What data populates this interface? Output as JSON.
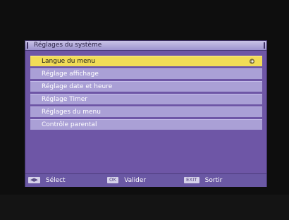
{
  "window": {
    "title": "Réglages du système"
  },
  "menu": {
    "items": [
      {
        "label": "Langue du menu"
      },
      {
        "label": "Réglage affichage"
      },
      {
        "label": "Réglage date et heure"
      },
      {
        "label": "Réglage Timer"
      },
      {
        "label": "Réglages du menu"
      },
      {
        "label": "Contrôle parental"
      }
    ],
    "selected_icon": "right-arrow-icon"
  },
  "footer": {
    "select": {
      "key": "◀▶",
      "label": "Sélect"
    },
    "ok": {
      "key": "OK",
      "label": "Valider"
    },
    "exit": {
      "key": "EXIT",
      "label": "Sortir"
    }
  },
  "colors": {
    "window_bg": "#6e56a6",
    "item_bg": "#aaa0d6",
    "selected_bg": "#f1dc57"
  }
}
